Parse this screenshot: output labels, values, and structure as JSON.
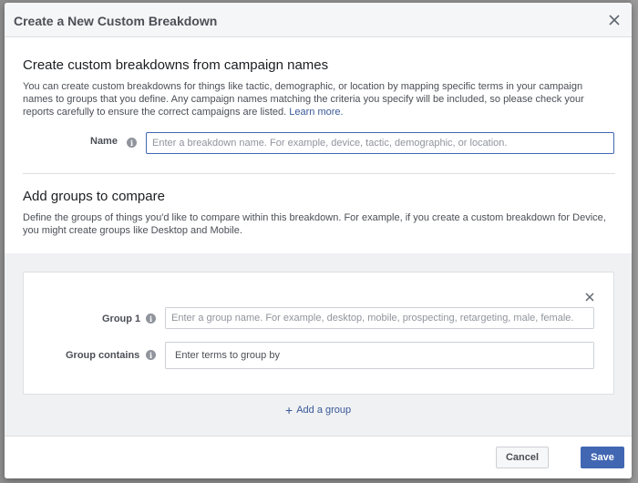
{
  "modal": {
    "title": "Create a New Custom Breakdown"
  },
  "section1": {
    "heading": "Create custom breakdowns from campaign names",
    "description": "You can create custom breakdowns for things like tactic, demographic, or location by mapping specific terms in your campaign names to groups that you define. Any campaign names matching the criteria you specify will be included, so please check your reports carefully to ensure the correct campaigns are listed.",
    "learn_more": "Learn more.",
    "name_label": "Name",
    "name_placeholder": "Enter a breakdown name. For example, device, tactic, demographic, or location."
  },
  "section2": {
    "heading": "Add groups to compare",
    "description": "Define the groups of things you'd like to compare within this breakdown. For example, if you create a custom breakdown for Device, you might create groups like Desktop and Mobile."
  },
  "group": {
    "group_label": "Group 1",
    "group_placeholder": "Enter a group name. For example, desktop, mobile, prospecting, retargeting, male, female.",
    "contains_label": "Group contains",
    "contains_placeholder": "Enter terms to group by"
  },
  "add_group_label": "Add a group",
  "footer": {
    "cancel_label": "Cancel",
    "save_label": "Save"
  },
  "colors": {
    "primary": "#4267b2",
    "link": "#385898",
    "header_bg": "#f5f6f7",
    "grey_area": "#f0f1f3"
  },
  "icons": [
    "close-icon",
    "info-icon",
    "plus-icon"
  ]
}
